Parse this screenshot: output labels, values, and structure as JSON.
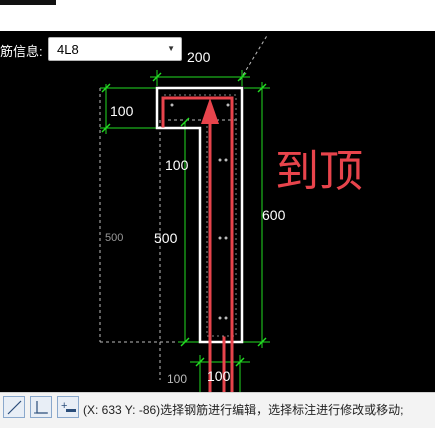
{
  "rebar_info": {
    "label": "筋信息:",
    "selected_value": "4L8"
  },
  "dimensions": {
    "top_width": "200",
    "left_height": "100",
    "mid_left": "100",
    "left_dashed": "500",
    "main_left": "500",
    "right_total": "600",
    "bottom_small": "100",
    "bottom_big": "100"
  },
  "annotation": {
    "text": "到顶",
    "color": "#e8444c"
  },
  "colors": {
    "outline": "#ffffff",
    "dimension": "#22dd22",
    "rebar": "#e8444c",
    "canvas": "#000000"
  },
  "statusbar": {
    "tools": [
      "line-tool-icon",
      "rebar-l-tool-icon",
      "rebar-u-tool-icon",
      "add-minus-tool-icon"
    ],
    "message": "(X: 633 Y: -86)选择钢筋进行编辑，选择标注进行修改或移动;"
  }
}
